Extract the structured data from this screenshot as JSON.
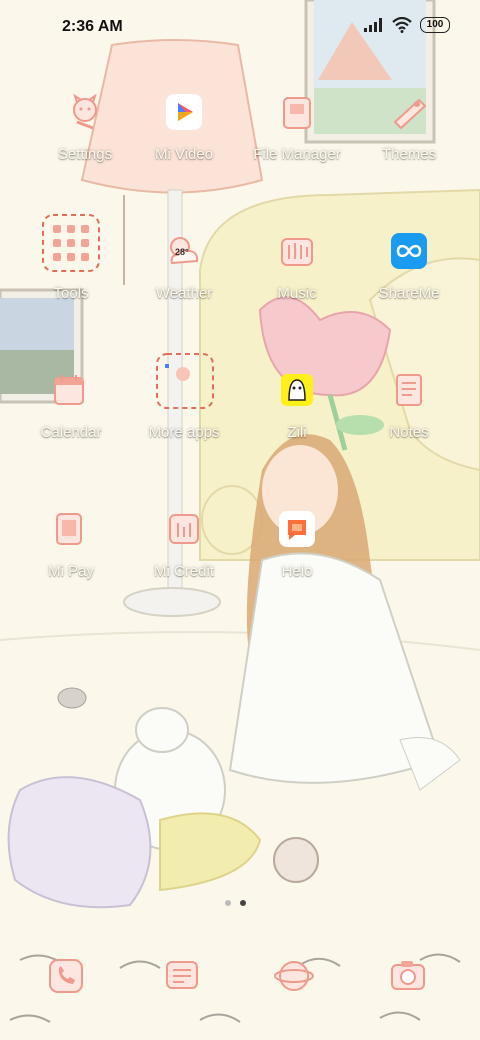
{
  "status_bar": {
    "time": "2:36 AM",
    "battery": "100"
  },
  "apps": [
    {
      "label": "Settings",
      "icon": "settings-icon"
    },
    {
      "label": "Mi Video",
      "icon": "mi-video-icon"
    },
    {
      "label": "File Manager",
      "icon": "file-manager-icon"
    },
    {
      "label": "Themes",
      "icon": "themes-icon"
    },
    {
      "label": "Tools",
      "icon": "tools-folder-icon"
    },
    {
      "label": "Weather",
      "icon": "weather-icon",
      "badge": "28°"
    },
    {
      "label": "Music",
      "icon": "music-icon"
    },
    {
      "label": "ShareMe",
      "icon": "shareme-icon"
    },
    {
      "label": "Calendar",
      "icon": "calendar-icon"
    },
    {
      "label": "More apps",
      "icon": "more-apps-folder-icon"
    },
    {
      "label": "Zili",
      "icon": "zili-icon"
    },
    {
      "label": "Notes",
      "icon": "notes-icon"
    },
    {
      "label": "Mi Pay",
      "icon": "mi-pay-icon"
    },
    {
      "label": "Mi Credit",
      "icon": "mi-credit-icon"
    },
    {
      "label": "Helo",
      "icon": "helo-icon"
    }
  ],
  "dock": [
    {
      "icon": "phone-icon"
    },
    {
      "icon": "messages-icon"
    },
    {
      "icon": "browser-icon"
    },
    {
      "icon": "camera-icon"
    }
  ],
  "page_indicator": {
    "pages": 2,
    "current": 2
  },
  "colors": {
    "icon_pink": "#ef9a8c",
    "label": "#fbf7ea",
    "wallpaper": "#fbf7ea"
  }
}
